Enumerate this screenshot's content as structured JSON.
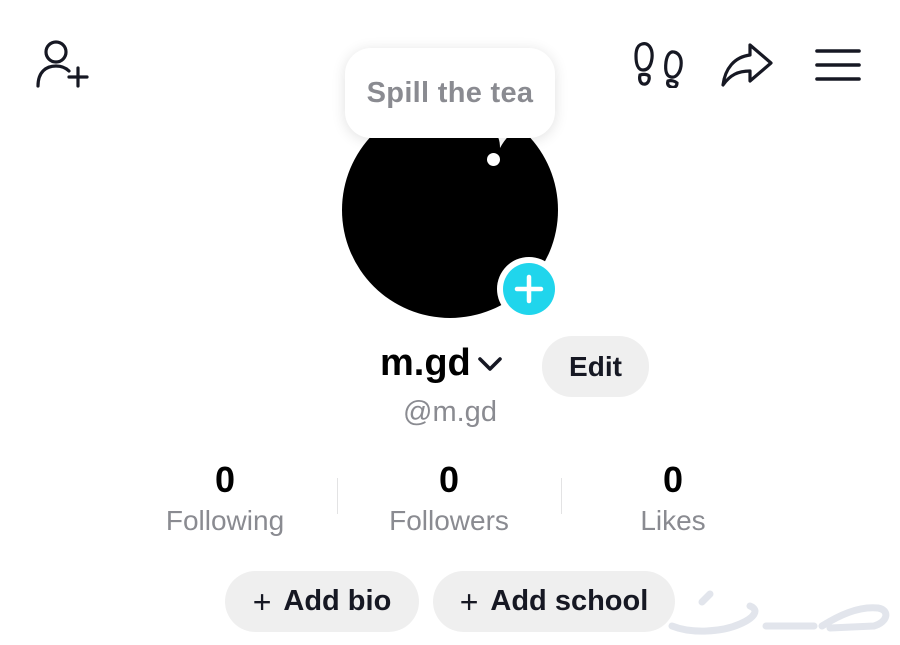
{
  "header": {
    "icons": [
      "add-friend-icon",
      "footprints-icon",
      "share-icon",
      "menu-icon"
    ]
  },
  "tooltip": {
    "text": "Spill the tea"
  },
  "profile": {
    "display_name": "m.gd",
    "edit_label": "Edit",
    "handle": "@m.gd"
  },
  "stats": [
    {
      "value": "0",
      "label": "Following"
    },
    {
      "value": "0",
      "label": "Followers"
    },
    {
      "value": "0",
      "label": "Likes"
    }
  ],
  "actions": {
    "add_bio": "Add bio",
    "add_school": "Add school"
  },
  "colors": {
    "accent": "#20d5ec",
    "muted_text": "#8a8b91",
    "pill_bg": "#efefef"
  }
}
